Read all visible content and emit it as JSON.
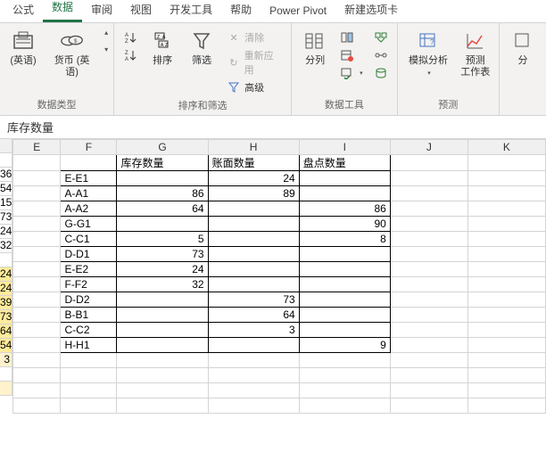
{
  "tabs": {
    "t0": "公式",
    "t1": "数据",
    "t2": "审阅",
    "t3": "视图",
    "t4": "开发工具",
    "t5": "帮助",
    "t6": "Power Pivot",
    "t7": "新建选项卡"
  },
  "ribbon": {
    "datatype": {
      "btn0": "(英语)",
      "btn1": "货币 (英语)",
      "label": "数据类型"
    },
    "sort": {
      "asc": "A↓Z",
      "desc": "Z↓A",
      "sort": "排序",
      "filter": "筛选",
      "clear": "清除",
      "reapply": "重新应用",
      "advanced": "高级",
      "label": "排序和筛选"
    },
    "tools": {
      "split": "分列",
      "label": "数据工具"
    },
    "forecast": {
      "sim": "模拟分析",
      "sheet": "预测\n工作表",
      "label": "预测"
    },
    "outline": {
      "label": "分"
    }
  },
  "formula_bar": "库存数量",
  "headers": {
    "E": "E",
    "F": "F",
    "G": "G",
    "H": "H",
    "I": "I",
    "J": "J",
    "K": "K"
  },
  "table": {
    "hdr_g": "库存数量",
    "hdr_h": "账面数量",
    "hdr_i": "盘点数量",
    "rows": [
      {
        "f": "E-E1",
        "g": "",
        "h": "24",
        "i": ""
      },
      {
        "f": "A-A1",
        "g": "86",
        "h": "89",
        "i": ""
      },
      {
        "f": "A-A2",
        "g": "64",
        "h": "",
        "i": "86"
      },
      {
        "f": "G-G1",
        "g": "",
        "h": "",
        "i": "90"
      },
      {
        "f": "C-C1",
        "g": "5",
        "h": "",
        "i": "8"
      },
      {
        "f": "D-D1",
        "g": "73",
        "h": "",
        "i": ""
      },
      {
        "f": "E-E2",
        "g": "24",
        "h": "",
        "i": ""
      },
      {
        "f": "F-F2",
        "g": "32",
        "h": "",
        "i": ""
      },
      {
        "f": "D-D2",
        "g": "",
        "h": "73",
        "i": ""
      },
      {
        "f": "B-B1",
        "g": "",
        "h": "64",
        "i": ""
      },
      {
        "f": "C-C2",
        "g": "",
        "h": "3",
        "i": ""
      },
      {
        "f": "H-H1",
        "g": "",
        "h": "",
        "i": "9"
      }
    ]
  },
  "leftvals": [
    "36",
    "54",
    "15",
    "73",
    "24",
    "32",
    "",
    "24",
    "24",
    "39",
    "73",
    "64",
    "54",
    "3"
  ]
}
